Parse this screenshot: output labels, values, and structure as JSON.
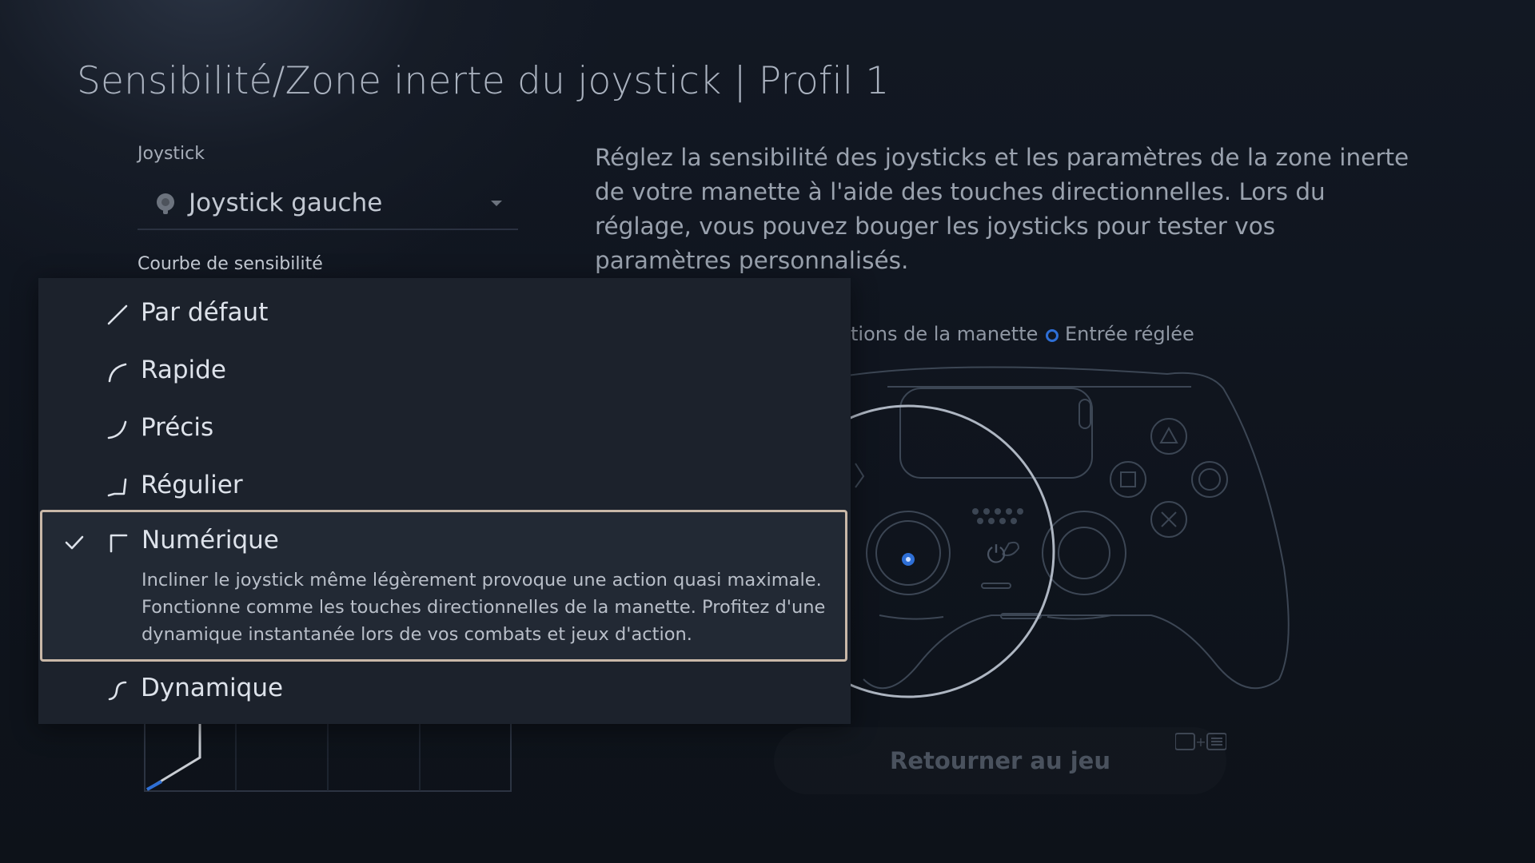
{
  "header": {
    "title": "Sensibilité/Zone inerte du joystick | Profil 1"
  },
  "joystick": {
    "label": "Joystick",
    "selected": "Joystick gauche"
  },
  "curve": {
    "label": "Courbe de sensibilité",
    "options": [
      {
        "label": "Par défaut",
        "icon": "curve-linear-icon"
      },
      {
        "label": "Rapide",
        "icon": "curve-quick-icon"
      },
      {
        "label": "Précis",
        "icon": "curve-precise-icon"
      },
      {
        "label": "Régulier",
        "icon": "curve-steady-icon"
      },
      {
        "label": "Numérique",
        "icon": "curve-digital-icon",
        "selected": true,
        "description": "Incliner le joystick même légèrement provoque une action quasi maximale. Fonctionne comme les touches directionnelles de la manette. Profitez d'une dynamique instantanée lors de vos combats et jeux d'action."
      },
      {
        "label": "Dynamique",
        "icon": "curve-dynamic-icon"
      }
    ]
  },
  "description": "Réglez la sensibilité des joysticks et les paramètres de la zone inerte de votre manette à l'aide des touches directionnelles. Lors du réglage, vous pouvez bouger les joysticks pour tester vos paramètres personnalisés.",
  "legend": {
    "input_partial": "tions de la manette",
    "adjusted": "Entrée réglée"
  },
  "footer": {
    "return_label": "Retourner au jeu"
  },
  "colors": {
    "accent": "#2e6fd6",
    "selection_border": "#c9b8a8",
    "panel": "#1c222c"
  }
}
